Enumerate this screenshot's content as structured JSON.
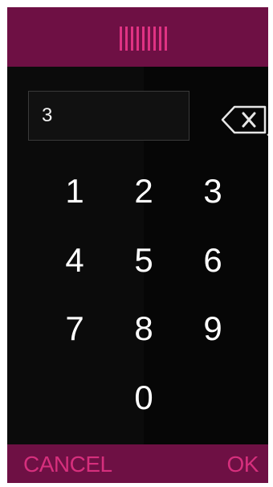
{
  "header": {
    "icon": "bars-icon",
    "accent_color": "#e03283",
    "background_color": "#6e1044"
  },
  "display": {
    "value": "3"
  },
  "backspace": {
    "icon": "backspace-icon"
  },
  "keypad": {
    "keys": [
      "1",
      "2",
      "3",
      "4",
      "5",
      "6",
      "7",
      "8",
      "9",
      "0"
    ]
  },
  "footer": {
    "cancel_label": "CANCEL",
    "ok_label": "OK",
    "label_color": "#d62f7d"
  }
}
